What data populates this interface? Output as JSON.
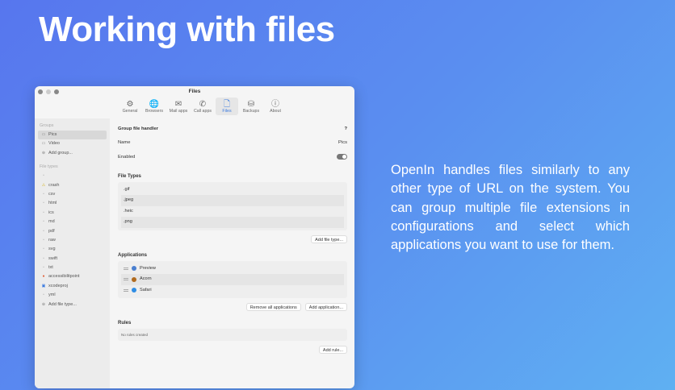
{
  "headline": "Working with files",
  "blurb": "OpenIn handles files similarly to any other type of URL on the system. You can group multiple file extensions in configurations and select which applications you want to use for them.",
  "window": {
    "title": "Files"
  },
  "toolbar": [
    {
      "label": "General",
      "icon": "gear-icon",
      "glyph": "⚙"
    },
    {
      "label": "Browsers",
      "icon": "globe-icon",
      "glyph": "🌐"
    },
    {
      "label": "Mail apps",
      "icon": "envelope-icon",
      "glyph": "✉"
    },
    {
      "label": "Call apps",
      "icon": "phone-icon",
      "glyph": "✆"
    },
    {
      "label": "Files",
      "icon": "document-icon",
      "glyph": "🗋"
    },
    {
      "label": "Backups",
      "icon": "drive-icon",
      "glyph": "⛁"
    },
    {
      "label": "About",
      "icon": "info-icon",
      "glyph": "ⓘ"
    }
  ],
  "sidebar": {
    "groups_header": "Groups",
    "groups": [
      "Pics",
      "Video"
    ],
    "add_group": "Add group...",
    "filetypes_header": "File types",
    "filetypes": [
      "",
      "crash",
      "csv",
      "html",
      "ics",
      "md",
      "pdf",
      "raw",
      "svg",
      "swift",
      "txt",
      "accessibilitpoint",
      "xcodeproj",
      "yml"
    ],
    "add_filetype": "Add file type..."
  },
  "main": {
    "group_title": "Group file handler",
    "help": "?",
    "name_label": "Name",
    "name_value": "Pics",
    "enabled_label": "Enabled",
    "enabled": true,
    "filetypes_title": "File Types",
    "filetypes": [
      ".gif",
      ".jpeg",
      ".heic",
      ".png"
    ],
    "add_filetype": "Add file type...",
    "apps_title": "Applications",
    "apps": [
      {
        "name": "Preview",
        "color": "#4a7fd0"
      },
      {
        "name": "Acorn",
        "color": "#b06a1e"
      },
      {
        "name": "Safari",
        "color": "#2f8de4"
      }
    ],
    "remove_all": "Remove all applications",
    "add_app": "Add application...",
    "rules_title": "Rules",
    "no_rules": "No rules created",
    "add_rule": "Add rule..."
  }
}
